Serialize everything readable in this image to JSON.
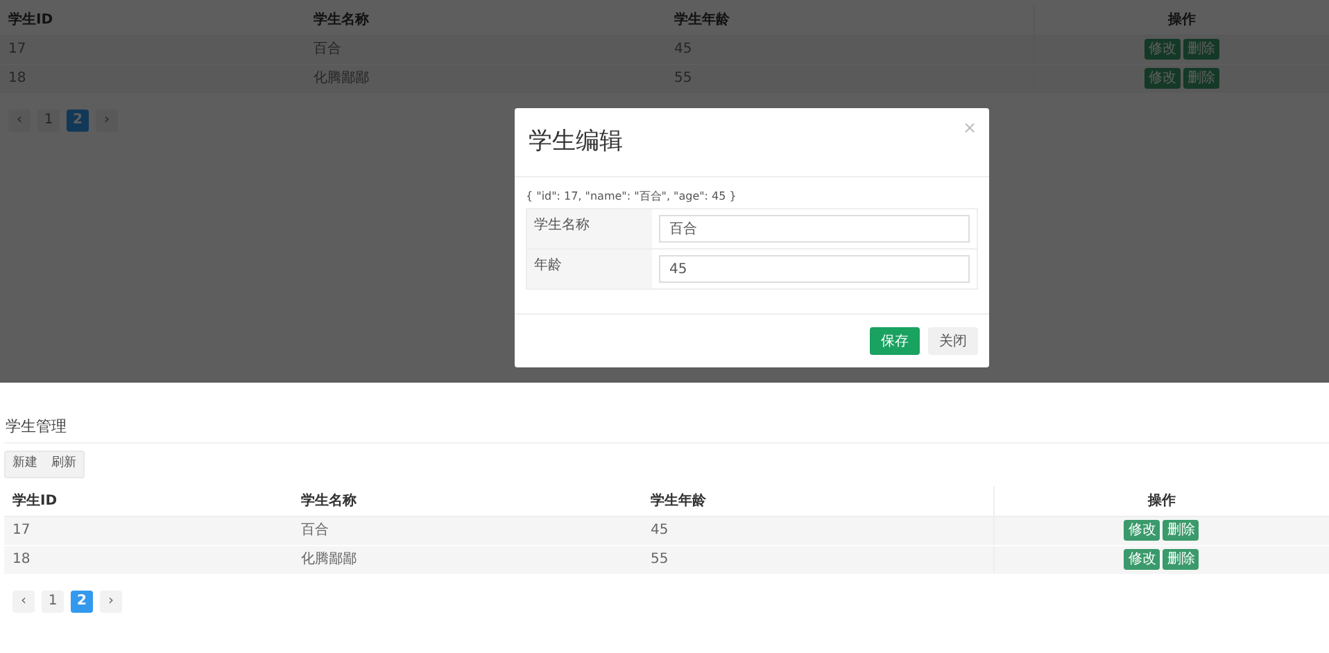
{
  "overlay_view": {
    "table": {
      "columns": [
        "学生ID",
        "学生名称",
        "学生年龄",
        "操作"
      ],
      "rows": [
        {
          "cells": [
            "17",
            "百合",
            "45"
          ],
          "actions": [
            "修改",
            "删除"
          ]
        },
        {
          "cells": [
            "18",
            "化腾鄙鄙",
            "55"
          ],
          "actions": [
            "修改",
            "删除"
          ]
        }
      ]
    },
    "pagination": [
      {
        "label": "‹",
        "selected": false
      },
      {
        "label": "1",
        "selected": false
      },
      {
        "label": "2",
        "selected": true
      },
      {
        "label": "›",
        "selected": false
      }
    ],
    "modal": {
      "title": "学生编辑",
      "close": "×",
      "json_text": "{ \"id\": 17, \"name\": \"百合\", \"age\": 45 }",
      "fields": [
        {
          "label": "学生名称",
          "value": "百合"
        },
        {
          "label": "年龄",
          "value": "45"
        }
      ],
      "buttons": [
        {
          "label": "保存",
          "kind": "primary"
        },
        {
          "label": "关闭",
          "kind": "secondary"
        }
      ]
    }
  },
  "page_view": {
    "title": "学生管理",
    "toolbar": [
      "新建",
      "刷新"
    ],
    "table": {
      "columns": [
        "学生ID",
        "学生名称",
        "学生年龄",
        "操作"
      ],
      "rows": [
        {
          "cells": [
            "17",
            "百合",
            "45"
          ],
          "actions": [
            "修改",
            "删除"
          ]
        },
        {
          "cells": [
            "18",
            "化腾鄙鄙",
            "55"
          ],
          "actions": [
            "修改",
            "删除"
          ]
        }
      ]
    },
    "pagination": [
      {
        "label": "‹",
        "selected": false
      },
      {
        "label": "1",
        "selected": false
      },
      {
        "label": "2",
        "selected": true
      },
      {
        "label": "›",
        "selected": false
      }
    ]
  }
}
